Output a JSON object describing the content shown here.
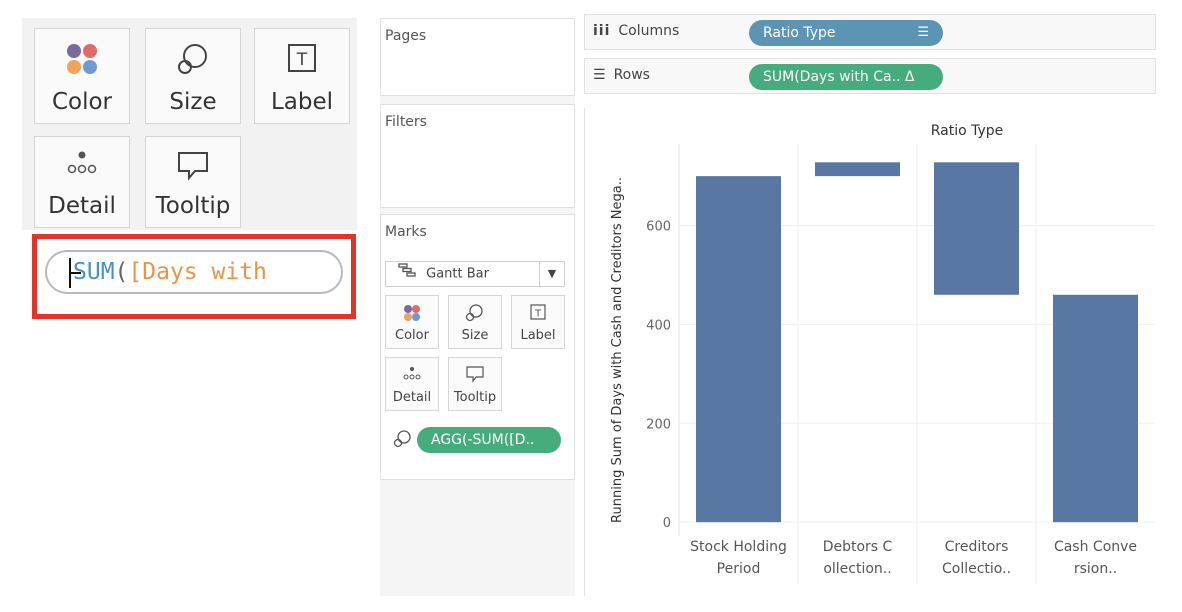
{
  "zoom_panel": {
    "color_label": "Color",
    "size_label": "Size",
    "label_label": "Label",
    "detail_label": "Detail",
    "tooltip_label": "Tooltip",
    "formula": {
      "func": "SUM",
      "paren": "(",
      "field": "[Days with"
    }
  },
  "left_column": {
    "pages_title": "Pages",
    "filters_title": "Filters",
    "marks_title": "Marks",
    "mark_type": "Gantt Bar",
    "buttons": {
      "color": "Color",
      "size": "Size",
      "label": "Label",
      "detail": "Detail",
      "tooltip": "Tooltip"
    },
    "size_pill": "AGG(-SUM([D.."
  },
  "shelves": {
    "columns_label": "Columns",
    "columns_pill": "Ratio Type",
    "rows_label": "Rows",
    "rows_pill": "SUM(Days with Ca.. Δ"
  },
  "colors": {
    "bar": "#5878a3",
    "pill_blue": "#5b95b3",
    "pill_green": "#47ac7b",
    "highlight": "#e0352b"
  },
  "chart_data": {
    "type": "gantt",
    "title": "Ratio Type",
    "ylabel": "Running Sum of Days with Cash and Creditors Nega..",
    "categories": [
      [
        "Stock Holding",
        "Period"
      ],
      [
        "Debtors C",
        "ollection.."
      ],
      [
        "Creditors",
        "Collectio.."
      ],
      [
        "Cash Conve",
        "rsion.."
      ]
    ],
    "bars": [
      {
        "start": 0,
        "end": 700
      },
      {
        "start": 700,
        "end": 728
      },
      {
        "start": 728,
        "end": 460
      },
      {
        "start": 0,
        "end": 460
      }
    ],
    "yticks": [
      0,
      200,
      400,
      600
    ],
    "ylim": [
      -28,
      765
    ],
    "grid": true
  }
}
